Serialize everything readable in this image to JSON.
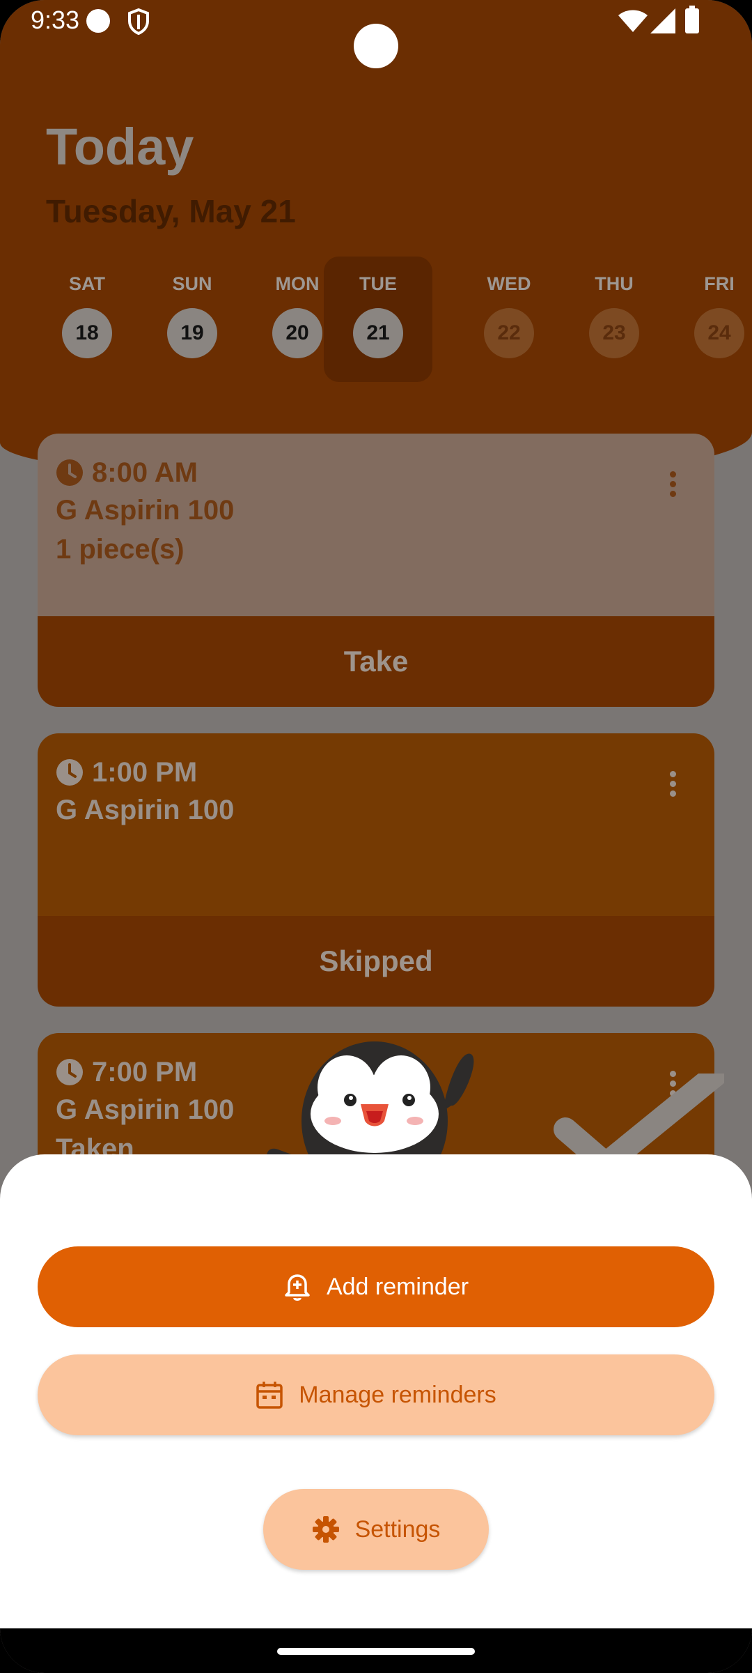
{
  "status_bar": {
    "time": "9:33"
  },
  "header": {
    "title": "Today",
    "subtitle": "Tuesday, May 21"
  },
  "days": [
    {
      "name": "SAT",
      "num": "18"
    },
    {
      "name": "SUN",
      "num": "19"
    },
    {
      "name": "MON",
      "num": "20"
    },
    {
      "name": "TUE",
      "num": "21"
    },
    {
      "name": "WED",
      "num": "22"
    },
    {
      "name": "THU",
      "num": "23"
    },
    {
      "name": "FRI",
      "num": "24"
    }
  ],
  "reminders": [
    {
      "time": "8:00 AM",
      "medicine": "G Aspirin 100",
      "dose": "1 piece(s)",
      "action": "Take"
    },
    {
      "time": "1:00 PM",
      "medicine": "G Aspirin 100",
      "action": "Skipped"
    },
    {
      "time": "7:00 PM",
      "medicine": "G Aspirin 100",
      "status": "Taken"
    }
  ],
  "sheet": {
    "add_label": "Add reminder",
    "manage_label": "Manage reminders",
    "settings_label": "Settings"
  },
  "colors": {
    "header": "#6b2e02",
    "primary": "#e06003",
    "secondary": "#fbc49c",
    "secondary_text": "#c65402"
  }
}
